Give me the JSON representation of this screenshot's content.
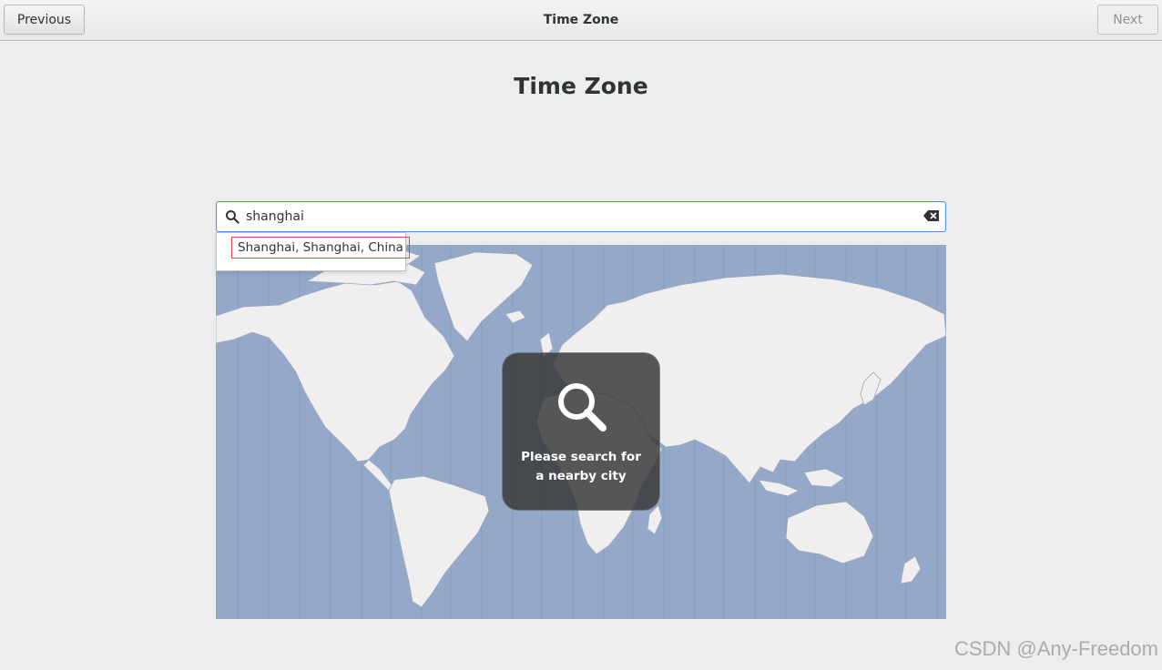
{
  "header": {
    "previous_label": "Previous",
    "title": "Time Zone",
    "next_label": "Next"
  },
  "page": {
    "heading": "Time Zone"
  },
  "search": {
    "value": "shanghai",
    "icon": "search-icon",
    "clear_icon": "clear-text-icon"
  },
  "results": [
    {
      "label": "Shanghai, Shanghai, China"
    }
  ],
  "map": {
    "overlay_icon": "search-icon",
    "overlay_line1": "Please search for",
    "overlay_line2": "a nearby city"
  },
  "watermark": "CSDN @Any-Freedom",
  "colors": {
    "accent": "#4a90d9",
    "ocean": "#94a9c9",
    "land": "#f0eeee",
    "highlight_border": "#d9434d"
  }
}
